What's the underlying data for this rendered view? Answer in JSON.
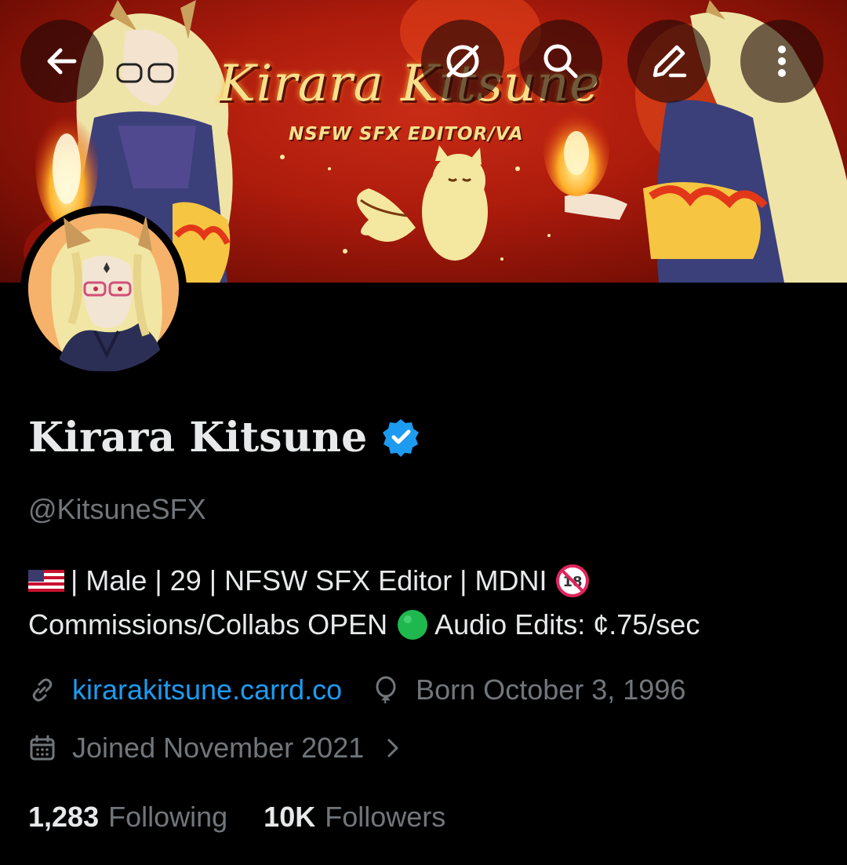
{
  "banner": {
    "title": "Kirara Kitsune",
    "subtitle": "NSFW SFX EDITOR/VA"
  },
  "toolbar": {
    "back_icon": "arrow-left-icon",
    "grok_icon": "grok-icon",
    "search_icon": "search-icon",
    "edit_icon": "edit-icon",
    "more_icon": "more-vertical-icon"
  },
  "profile": {
    "display_name": "Kirara Kitsune",
    "verified_icon": "verified-badge-icon",
    "verified_color": "#1d9bf0",
    "handle": "@KitsuneSFX",
    "bio": {
      "line1_text": "| Male | 29 | NFSW SFX Editor | MDNI",
      "line1_flag_icon": "us-flag-emoji",
      "line1_end_icon": "no-under-18-emoji",
      "line2_prefix": "Commissions/Collabs OPEN",
      "line2_status_icon": "green-circle-emoji",
      "line2_suffix": "Audio Edits: ¢.75/sec"
    },
    "website": "kirarakitsune.carrd.co",
    "birthday": "Born October 3, 1996",
    "joined": "Joined November 2021",
    "following_count": "1,283",
    "following_label": "Following",
    "followers_count": "10K",
    "followers_label": "Followers"
  },
  "colors": {
    "background": "#000000",
    "text_primary": "#e7e9ea",
    "text_secondary": "#71767b",
    "link": "#1d9bf0",
    "banner_red": "#c2200f",
    "banner_gold": "#f7e08c"
  }
}
